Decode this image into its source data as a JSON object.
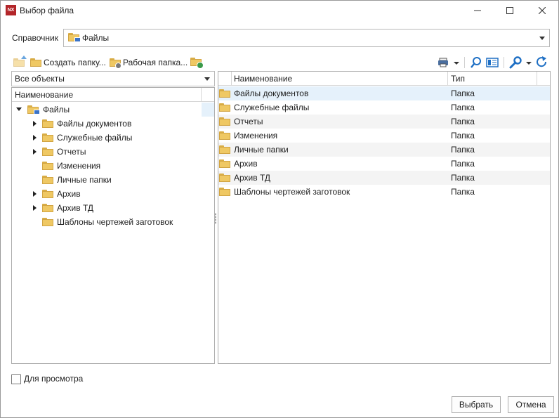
{
  "window": {
    "title": "Выбор файла",
    "app_icon_text": "NX"
  },
  "directory": {
    "label": "Справочник",
    "value": "Файлы"
  },
  "toolbar": {
    "create_folder": "Создать папку...",
    "work_folder": "Рабочая папка..."
  },
  "filter": {
    "value": "Все объекты"
  },
  "tree": {
    "column": "Наименование",
    "root": "Файлы",
    "items": [
      {
        "label": "Файлы документов",
        "expandable": true
      },
      {
        "label": "Служебные файлы",
        "expandable": true
      },
      {
        "label": "Отчеты",
        "expandable": true
      },
      {
        "label": "Изменения",
        "expandable": false
      },
      {
        "label": "Личные папки",
        "expandable": false
      },
      {
        "label": "Архив",
        "expandable": true
      },
      {
        "label": "Архив ТД",
        "expandable": true
      },
      {
        "label": "Шаблоны чертежей заготовок",
        "expandable": false
      }
    ]
  },
  "list": {
    "columns": [
      "Наименование",
      "Тип"
    ],
    "rows": [
      {
        "name": "Файлы документов",
        "type": "Папка"
      },
      {
        "name": "Служебные файлы",
        "type": "Папка"
      },
      {
        "name": "Отчеты",
        "type": "Папка"
      },
      {
        "name": "Изменения",
        "type": "Папка"
      },
      {
        "name": "Личные папки",
        "type": "Папка"
      },
      {
        "name": "Архив",
        "type": "Папка"
      },
      {
        "name": "Архив ТД",
        "type": "Папка"
      },
      {
        "name": "Шаблоны чертежей заготовок",
        "type": "Папка"
      }
    ]
  },
  "preview_checkbox": {
    "label": "Для просмотра",
    "checked": false
  },
  "buttons": {
    "select": "Выбрать",
    "cancel": "Отмена"
  },
  "colors": {
    "selection": "#e5f1fb",
    "alt_row": "#f4f4f4",
    "folder": "#efc863",
    "accent_blue": "#1e6fc4"
  }
}
